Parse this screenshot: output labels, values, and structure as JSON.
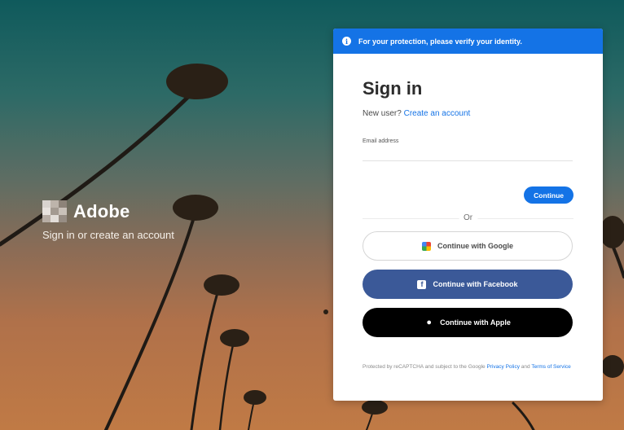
{
  "brand": {
    "name": "Adobe",
    "subtitle": "Sign in or create an account"
  },
  "banner": {
    "icon": "info-icon",
    "text": "For your protection, please verify your identity."
  },
  "signin": {
    "title": "Sign in",
    "new_user_prefix": "New user?",
    "create_account_link": "Create an account",
    "email_label": "Email address",
    "email_value": "",
    "continue_label": "Continue",
    "or_label": "Or"
  },
  "social": {
    "google": "Continue with Google",
    "facebook": "Continue with Facebook",
    "apple": "Continue with Apple"
  },
  "legal": {
    "prefix": "Protected by reCAPTCHA and subject to the Google",
    "privacy": "Privacy Policy",
    "and": "and",
    "terms": "Terms of Service"
  },
  "colors": {
    "accent": "#1473e6",
    "facebook": "#3b5998",
    "apple": "#000000"
  }
}
